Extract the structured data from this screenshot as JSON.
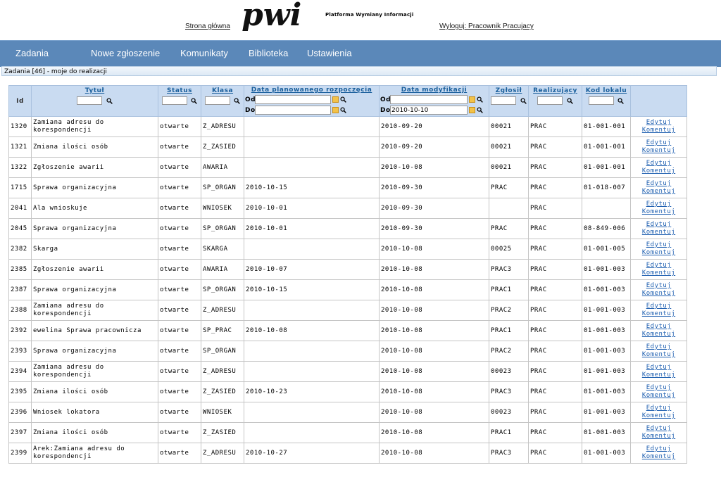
{
  "header": {
    "home_link": "Strona główna",
    "logo_text": "pwi",
    "logo_tagline": "Platforma Wymiany Informacji",
    "logout_link": "Wyloguj: Pracownik Pracujacy"
  },
  "nav": {
    "items": [
      "Zadania",
      "Nowe zgłoszenie",
      "Komunikaty",
      "Biblioteka",
      "Ustawienia"
    ]
  },
  "section_title": "Zadania [46] - moje do realizacji",
  "table": {
    "headers": {
      "id": "Id",
      "title": "Tytuł",
      "status": "Status",
      "class": "Klasa",
      "planned": "Data planowanego rozpoczęcia",
      "modified": "Data modyfikacji",
      "reported": "Zgłosił",
      "realizing": "Realizujący",
      "location": "Kod lokalu"
    },
    "filters": {
      "from_label": "Od",
      "to_label": "Do",
      "modified_to_value": "2010-10-10"
    },
    "action_edit": "Edytuj",
    "action_comment": "Komentuj",
    "rows": [
      {
        "id": "1320",
        "title": "Zamiana adresu do korespondencji",
        "status": "otwarte",
        "klasa": "Z_ADRESU",
        "planned": "",
        "modified": "2010-09-20",
        "reported": "00021",
        "realizing": "PRAC",
        "location": "01-001-001"
      },
      {
        "id": "1321",
        "title": "Zmiana ilości osób",
        "status": "otwarte",
        "klasa": "Z_ZASIED",
        "planned": "",
        "modified": "2010-09-20",
        "reported": "00021",
        "realizing": "PRAC",
        "location": "01-001-001"
      },
      {
        "id": "1322",
        "title": "Zgłoszenie awarii",
        "status": "otwarte",
        "klasa": "AWARIA",
        "planned": "",
        "modified": "2010-10-08",
        "reported": "00021",
        "realizing": "PRAC",
        "location": "01-001-001"
      },
      {
        "id": "1715",
        "title": "Sprawa organizacyjna",
        "status": "otwarte",
        "klasa": "SP_ORGAN",
        "planned": "2010-10-15",
        "modified": "2010-09-30",
        "reported": "PRAC",
        "realizing": "PRAC",
        "location": "01-018-007"
      },
      {
        "id": "2041",
        "title": "Ala wnioskuje",
        "status": "otwarte",
        "klasa": "WNIOSEK",
        "planned": "2010-10-01",
        "modified": "2010-09-30",
        "reported": "",
        "realizing": "PRAC",
        "location": ""
      },
      {
        "id": "2045",
        "title": "Sprawa organizacyjna",
        "status": "otwarte",
        "klasa": "SP_ORGAN",
        "planned": "2010-10-01",
        "modified": "2010-09-30",
        "reported": "PRAC",
        "realizing": "PRAC",
        "location": "08-849-006"
      },
      {
        "id": "2382",
        "title": "Skarga",
        "status": "otwarte",
        "klasa": "SKARGA",
        "planned": "",
        "modified": "2010-10-08",
        "reported": "00025",
        "realizing": "PRAC",
        "location": "01-001-005"
      },
      {
        "id": "2385",
        "title": "Zgłoszenie awarii",
        "status": "otwarte",
        "klasa": "AWARIA",
        "planned": "2010-10-07",
        "modified": "2010-10-08",
        "reported": "PRAC3",
        "realizing": "PRAC",
        "location": "01-001-003"
      },
      {
        "id": "2387",
        "title": "Sprawa organizacyjna",
        "status": "otwarte",
        "klasa": "SP_ORGAN",
        "planned": "2010-10-15",
        "modified": "2010-10-08",
        "reported": "PRAC1",
        "realizing": "PRAC",
        "location": "01-001-003"
      },
      {
        "id": "2388",
        "title": "Zamiana adresu do korespondencji",
        "status": "otwarte",
        "klasa": "Z_ADRESU",
        "planned": "",
        "modified": "2010-10-08",
        "reported": "PRAC2",
        "realizing": "PRAC",
        "location": "01-001-003"
      },
      {
        "id": "2392",
        "title": "ewelina Sprawa pracownicza",
        "status": "otwarte",
        "klasa": "SP_PRAC",
        "planned": "2010-10-08",
        "modified": "2010-10-08",
        "reported": "PRAC1",
        "realizing": "PRAC",
        "location": "01-001-003"
      },
      {
        "id": "2393",
        "title": "Sprawa organizacyjna",
        "status": "otwarte",
        "klasa": "SP_ORGAN",
        "planned": "",
        "modified": "2010-10-08",
        "reported": "PRAC2",
        "realizing": "PRAC",
        "location": "01-001-003"
      },
      {
        "id": "2394",
        "title": "Zamiana adresu do korespondencji",
        "status": "otwarte",
        "klasa": "Z_ADRESU",
        "planned": "",
        "modified": "2010-10-08",
        "reported": "00023",
        "realizing": "PRAC",
        "location": "01-001-003"
      },
      {
        "id": "2395",
        "title": "Zmiana ilości osób",
        "status": "otwarte",
        "klasa": "Z_ZASIED",
        "planned": "2010-10-23",
        "modified": "2010-10-08",
        "reported": "PRAC3",
        "realizing": "PRAC",
        "location": "01-001-003"
      },
      {
        "id": "2396",
        "title": "Wniosek lokatora",
        "status": "otwarte",
        "klasa": "WNIOSEK",
        "planned": "",
        "modified": "2010-10-08",
        "reported": "00023",
        "realizing": "PRAC",
        "location": "01-001-003"
      },
      {
        "id": "2397",
        "title": "Zmiana ilości osób",
        "status": "otwarte",
        "klasa": "Z_ZASIED",
        "planned": "",
        "modified": "2010-10-08",
        "reported": "PRAC1",
        "realizing": "PRAC",
        "location": "01-001-003"
      },
      {
        "id": "2399",
        "title": "Arek:Zamiana adresu do korespondencji",
        "status": "otwarte",
        "klasa": "Z_ADRESU",
        "planned": "2010-10-27",
        "modified": "2010-10-08",
        "reported": "PRAC3",
        "realizing": "PRAC",
        "location": "01-001-003"
      }
    ]
  }
}
